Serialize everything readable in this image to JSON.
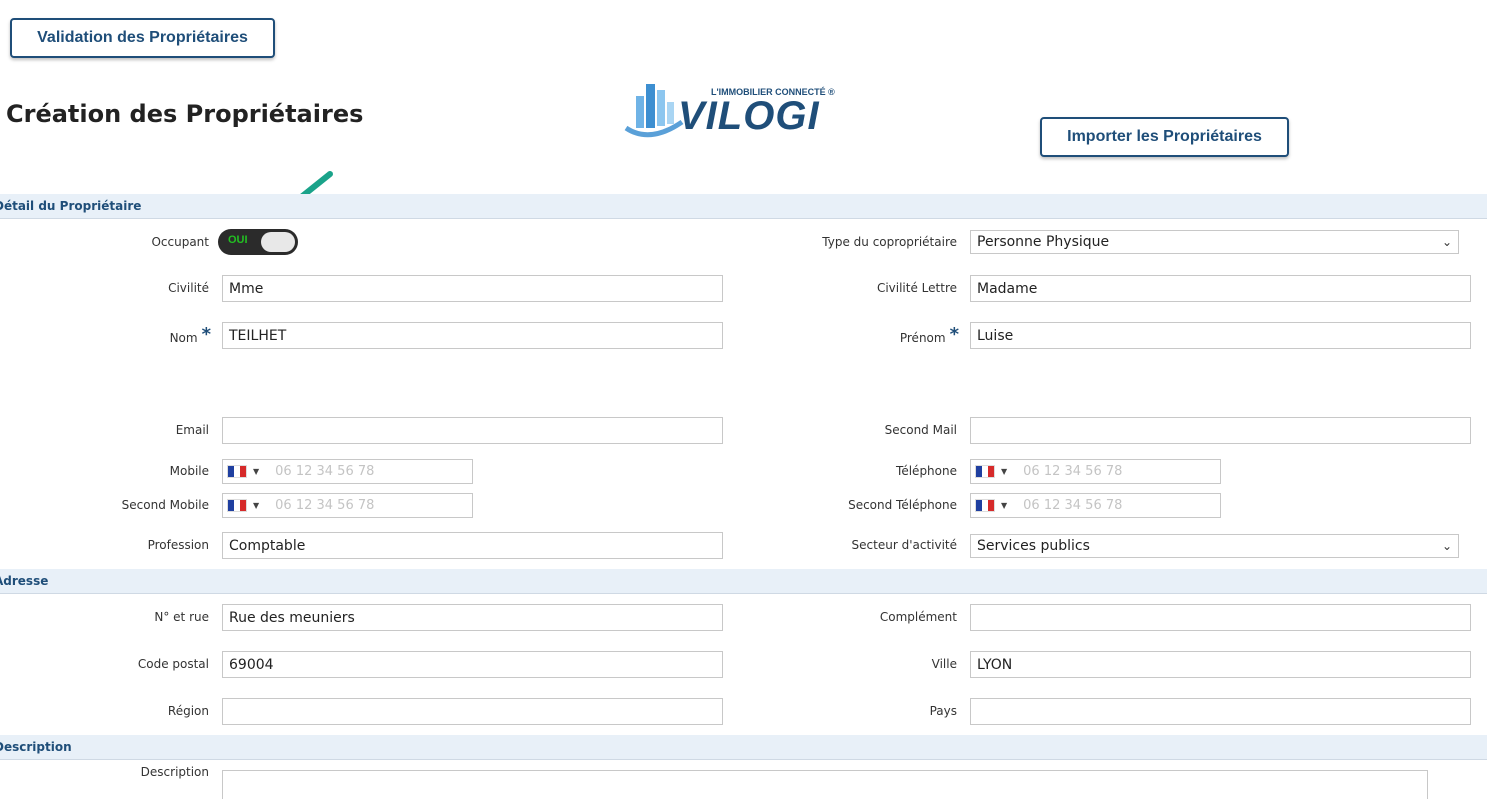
{
  "header": {
    "validation_button": "Validation des Propriétaires",
    "page_title": "Création des Propriétaires",
    "import_button": "Importer les Propriétaires",
    "logo": {
      "tagline": "L'IMMOBILIER CONNECTÉ ®",
      "brand": "VILOGI"
    }
  },
  "sections": {
    "detail": "Détail du Propriétaire",
    "address": "Adresse",
    "description": "Description"
  },
  "detail": {
    "occupant": {
      "label": "Occupant",
      "toggle_text": "OUI",
      "on": true
    },
    "type": {
      "label": "Type du copropriétaire",
      "value": "Personne Physique"
    },
    "civilite": {
      "label": "Civilité",
      "value": "Mme"
    },
    "civilite_lettre": {
      "label": "Civilité Lettre",
      "value": "Madame"
    },
    "nom": {
      "label": "Nom",
      "value": "TEILHET",
      "required": "*"
    },
    "prenom": {
      "label": "Prénom",
      "value": "Luise",
      "required": "*"
    },
    "email": {
      "label": "Email",
      "value": ""
    },
    "second_mail": {
      "label": "Second Mail",
      "value": ""
    },
    "mobile": {
      "label": "Mobile",
      "placeholder": "06 12 34 56 78"
    },
    "telephone": {
      "label": "Téléphone",
      "placeholder": "06 12 34 56 78"
    },
    "second_mobile": {
      "label": "Second Mobile",
      "placeholder": "06 12 34 56 78"
    },
    "second_telephone": {
      "label": "Second Téléphone",
      "placeholder": "06 12 34 56 78"
    },
    "profession": {
      "label": "Profession",
      "value": "Comptable"
    },
    "secteur": {
      "label": "Secteur d'activité",
      "value": "Services publics"
    }
  },
  "address": {
    "rue": {
      "label": "N° et rue",
      "value": "Rue des meuniers"
    },
    "complement": {
      "label": "Complément",
      "value": ""
    },
    "code_postal": {
      "label": "Code postal",
      "value": "69004"
    },
    "ville": {
      "label": "Ville",
      "value": "LYON"
    },
    "region": {
      "label": "Région",
      "value": ""
    },
    "pays": {
      "label": "Pays",
      "value": ""
    }
  },
  "description": {
    "label": "Description",
    "value": ""
  },
  "colors": {
    "accent": "#1f4e79",
    "section_bg": "#e8f0f8",
    "arrow": "#1aa38a",
    "toggle_on": "#22c022"
  }
}
